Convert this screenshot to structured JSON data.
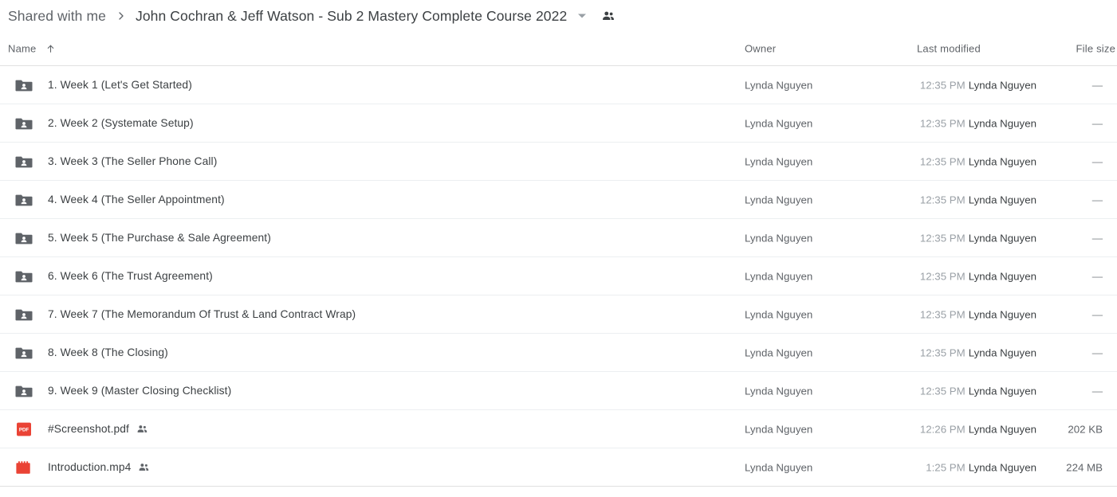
{
  "breadcrumb": {
    "root_label": "Shared with me",
    "separator": "chevron-right-icon",
    "current_label": "John Cochran & Jeff Watson - Sub 2 Mastery Complete Course 2022",
    "caret_icon": "chevron-down-icon",
    "people_icon": "people-shared-icon"
  },
  "columns": {
    "name": "Name",
    "name_sort": "arrow-up-icon",
    "owner": "Owner",
    "last_modified": "Last modified",
    "file_size": "File size"
  },
  "colors": {
    "text_primary": "#3c4043",
    "text_secondary": "#5f6368",
    "text_muted": "#9aa0a6",
    "divider": "#eceff1",
    "folder_icon": "#5f6368",
    "pdf_icon": "#ea4335",
    "video_icon": "#ea4335",
    "background": "#ffffff"
  },
  "rows": [
    {
      "icon": "shared-folder-icon",
      "type": "folder",
      "name": "1. Week 1 (Let's Get Started)",
      "shared": false,
      "owner": "Lynda Nguyen",
      "modified_time": "12:35 PM",
      "modified_by": "Lynda Nguyen",
      "size": "—"
    },
    {
      "icon": "shared-folder-icon",
      "type": "folder",
      "name": "2. Week 2 (Systemate Setup)",
      "shared": false,
      "owner": "Lynda Nguyen",
      "modified_time": "12:35 PM",
      "modified_by": "Lynda Nguyen",
      "size": "—"
    },
    {
      "icon": "shared-folder-icon",
      "type": "folder",
      "name": "3. Week 3 (The Seller Phone Call)",
      "shared": false,
      "owner": "Lynda Nguyen",
      "modified_time": "12:35 PM",
      "modified_by": "Lynda Nguyen",
      "size": "—"
    },
    {
      "icon": "shared-folder-icon",
      "type": "folder",
      "name": "4. Week 4 (The Seller Appointment)",
      "shared": false,
      "owner": "Lynda Nguyen",
      "modified_time": "12:35 PM",
      "modified_by": "Lynda Nguyen",
      "size": "—"
    },
    {
      "icon": "shared-folder-icon",
      "type": "folder",
      "name": "5. Week 5 (The Purchase & Sale Agreement)",
      "shared": false,
      "owner": "Lynda Nguyen",
      "modified_time": "12:35 PM",
      "modified_by": "Lynda Nguyen",
      "size": "—"
    },
    {
      "icon": "shared-folder-icon",
      "type": "folder",
      "name": "6. Week 6 (The Trust Agreement)",
      "shared": false,
      "owner": "Lynda Nguyen",
      "modified_time": "12:35 PM",
      "modified_by": "Lynda Nguyen",
      "size": "—"
    },
    {
      "icon": "shared-folder-icon",
      "type": "folder",
      "name": "7. Week 7 (The Memorandum Of Trust & Land Contract Wrap)",
      "shared": false,
      "owner": "Lynda Nguyen",
      "modified_time": "12:35 PM",
      "modified_by": "Lynda Nguyen",
      "size": "—"
    },
    {
      "icon": "shared-folder-icon",
      "type": "folder",
      "name": "8. Week 8 (The Closing)",
      "shared": false,
      "owner": "Lynda Nguyen",
      "modified_time": "12:35 PM",
      "modified_by": "Lynda Nguyen",
      "size": "—"
    },
    {
      "icon": "shared-folder-icon",
      "type": "folder",
      "name": "9. Week 9 (Master Closing Checklist)",
      "shared": false,
      "owner": "Lynda Nguyen",
      "modified_time": "12:35 PM",
      "modified_by": "Lynda Nguyen",
      "size": "—"
    },
    {
      "icon": "pdf-file-icon",
      "type": "pdf",
      "name": "#Screenshot.pdf",
      "shared": true,
      "owner": "Lynda Nguyen",
      "modified_time": "12:26 PM",
      "modified_by": "Lynda Nguyen",
      "size": "202 KB"
    },
    {
      "icon": "video-file-icon",
      "type": "video",
      "name": "Introduction.mp4",
      "shared": true,
      "owner": "Lynda Nguyen",
      "modified_time": "1:25 PM",
      "modified_by": "Lynda Nguyen",
      "size": "224 MB"
    }
  ]
}
